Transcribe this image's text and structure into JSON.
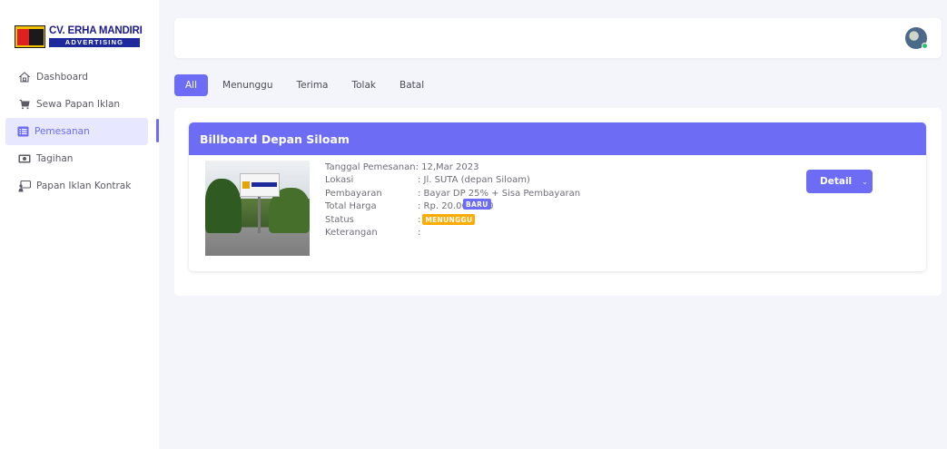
{
  "brand": {
    "mark": "EM",
    "title": "CV. ERHA MANDIRI",
    "subtitle": "ADVERTISING"
  },
  "sidebar": {
    "items": [
      {
        "label": "Dashboard",
        "icon": "home-icon",
        "active": false
      },
      {
        "label": "Sewa Papan Iklan",
        "icon": "cart-icon",
        "active": false
      },
      {
        "label": "Pemesanan",
        "icon": "list-icon",
        "active": true
      },
      {
        "label": "Tagihan",
        "icon": "money-icon",
        "active": false
      },
      {
        "label": "Papan Iklan Kontrak",
        "icon": "billboard-icon",
        "active": false
      }
    ]
  },
  "tabs": [
    {
      "label": "All",
      "active": true
    },
    {
      "label": "Menunggu",
      "active": false
    },
    {
      "label": "Terima",
      "active": false
    },
    {
      "label": "Tolak",
      "active": false
    },
    {
      "label": "Batal",
      "active": false
    }
  ],
  "order": {
    "title": "Billboard Depan Siloam",
    "fields": {
      "tanggal_label": "Tanggal Pemesanan",
      "tanggal_value": ": 12,Mar 2023",
      "lokasi_label": "Lokasi",
      "lokasi_value": ": Jl. SUTA (depan Siloam)",
      "pembayaran_label": "Pembayaran",
      "pembayaran_value": ": Bayar DP 25% + Sisa Pembayaran",
      "harga_label": "Total Harga",
      "harga_value": ": Rp. 20.000.000",
      "status_label": "Status",
      "status_badge": "MENUNGGU",
      "keterangan_label": "Keterangan",
      "keterangan_badge": "BARU",
      "separator": ":"
    },
    "detail_button": "Detail",
    "detail_caret": "⌄"
  },
  "colors": {
    "primary": "#6c6cf5",
    "warning": "#ffab00",
    "online": "#27c26c"
  }
}
